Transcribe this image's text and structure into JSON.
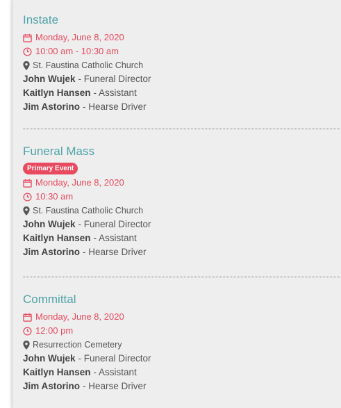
{
  "events": [
    {
      "title": "Instate",
      "badge": "",
      "date": "Monday, June 8, 2020",
      "time": "10:00 am - 10:30 am",
      "location": "St. Faustina Catholic Church",
      "staff": [
        {
          "name": "John Wujek",
          "role": "- Funeral Director"
        },
        {
          "name": "Kaitlyn Hansen",
          "role": "- Assistant"
        },
        {
          "name": "Jim Astorino",
          "role": "- Hearse Driver"
        }
      ]
    },
    {
      "title": "Funeral Mass",
      "badge": "Primary Event",
      "date": "Monday, June 8, 2020",
      "time": "10:30 am",
      "location": "St. Faustina Catholic Church",
      "staff": [
        {
          "name": "John Wujek",
          "role": "- Funeral Director"
        },
        {
          "name": "Kaitlyn Hansen",
          "role": "- Assistant"
        },
        {
          "name": "Jim Astorino",
          "role": "- Hearse Driver"
        }
      ]
    },
    {
      "title": "Committal",
      "badge": "",
      "date": "Monday, June 8, 2020",
      "time": "12:00 pm",
      "location": "Resurrection Cemetery",
      "staff": [
        {
          "name": "John Wujek",
          "role": "- Funeral Director"
        },
        {
          "name": "Kaitlyn Hansen",
          "role": "- Assistant"
        },
        {
          "name": "Jim Astorino",
          "role": "- Hearse Driver"
        }
      ]
    }
  ],
  "icons": {
    "edit": "edit-icon",
    "date": "calendar-icon",
    "time": "clock-icon",
    "location": "map-marker-icon"
  },
  "colors": {
    "title": "#4fa3a8",
    "accent": "#e84a5f",
    "panel": "#eeeeee",
    "text": "#555555"
  }
}
